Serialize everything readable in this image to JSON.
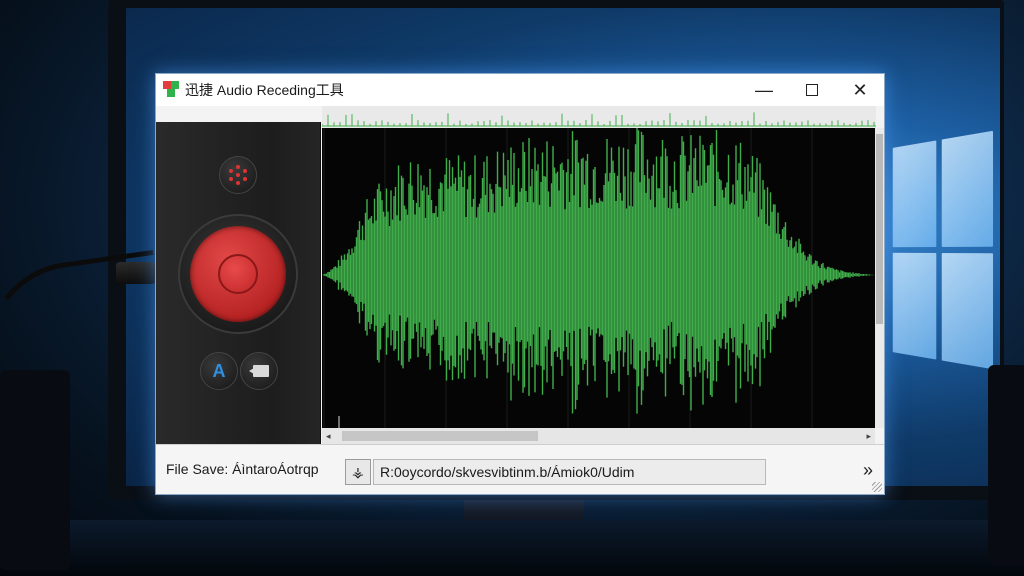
{
  "window": {
    "title": "迅捷 Audio Receding工具",
    "minimize_glyph": "—",
    "close_glyph": "✕"
  },
  "controls": {
    "record_button": "record",
    "font_icon_glyph": "A"
  },
  "waveform": {
    "color": "#3fae4a",
    "background": "#050505",
    "scroll_left_glyph": "◂",
    "scroll_right_glyph": "▸"
  },
  "footer": {
    "save_label": "File Save: ÁìntaroÁotrqp",
    "browse_glyph": "⚶",
    "path_value": "R:0oycordo/skvesvibtinm.b/Ámiok0/Udim",
    "more_glyph": "»"
  },
  "colors": {
    "accent_red": "#c72b2b",
    "accent_green": "#3fae4a",
    "accent_blue": "#2f8fe0"
  }
}
